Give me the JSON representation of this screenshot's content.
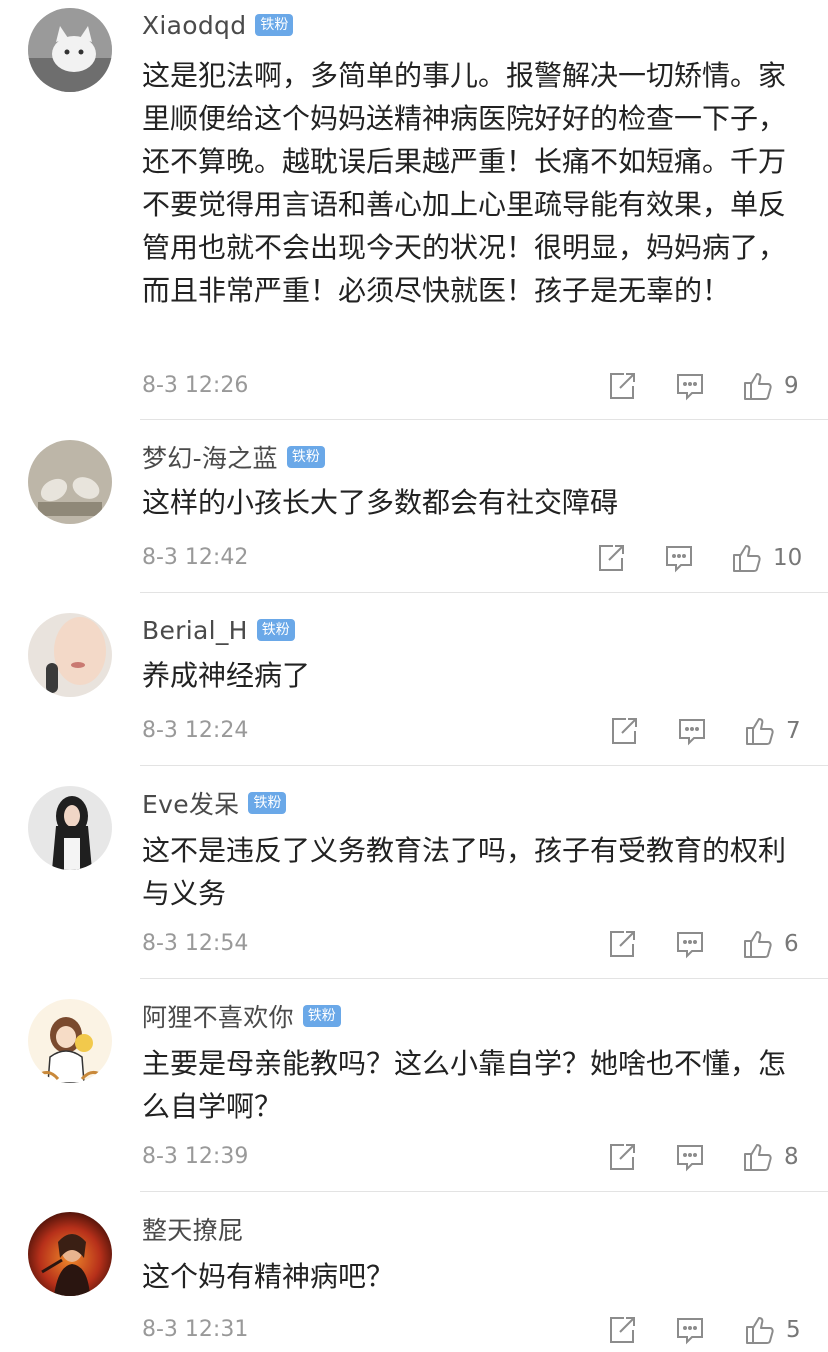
{
  "comments": [
    {
      "username": "Xiaodqd",
      "badge": "铁粉",
      "avatar": "white-cat-photo-avatar",
      "text": "这是犯法啊，多简单的事儿。报警解决一切矫情。家里顺便给这个妈妈送精神病医院好好的检查一下子，还不算晚。越耽误后果越严重！长痛不如短痛。千万不要觉得用言语和善心加上心里疏导能有效果，单反管用也就不会出现今天的状况！很明显，妈妈病了，而且非常严重！必须尽快就医！孩子是无辜的！",
      "timestamp": "8-3 12:26",
      "likes": "9"
    },
    {
      "username": "梦幻-海之蓝",
      "badge": "铁粉",
      "avatar": "sneakers-photo-avatar",
      "text": "这样的小孩长大了多数都会有社交障碍",
      "timestamp": "8-3 12:42",
      "likes": "10"
    },
    {
      "username": "Berial_H",
      "badge": "铁粉",
      "avatar": "face-closeup-photo-avatar",
      "text": "养成神经病了",
      "timestamp": "8-3 12:24",
      "likes": "7"
    },
    {
      "username": "Eve发呆",
      "badge": "铁粉",
      "avatar": "long-hair-girl-photo-avatar",
      "text": "这不是违反了义务教育法了吗，孩子有受教育的权利与义务",
      "timestamp": "8-3 12:54",
      "likes": "6"
    },
    {
      "username": "阿狸不喜欢你",
      "badge": "铁粉",
      "avatar": "illustrated-girl-avatar",
      "text": "主要是母亲能教吗？这么小靠自学？她啥也不懂，怎么自学啊？",
      "timestamp": "8-3 12:39",
      "likes": "8"
    },
    {
      "username": "整天撩屁",
      "badge": "",
      "avatar": "movie-poster-portrait-avatar",
      "text": "这个妈有精神病吧？",
      "timestamp": "8-3 12:31",
      "likes": "5"
    }
  ],
  "icons": {
    "share": "share-icon",
    "reply": "reply-icon",
    "like": "thumbs-up-icon"
  },
  "colors": {
    "badge": "#6aa8e8",
    "username": "#4a4a4a",
    "text": "#222222",
    "meta": "#999999",
    "divider": "#e3e3e3"
  }
}
